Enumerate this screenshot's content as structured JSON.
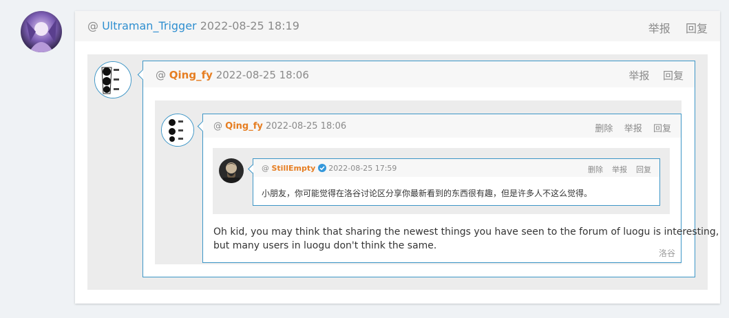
{
  "outer": {
    "at": "@",
    "username": "Ultraman_Trigger",
    "time": "2022-08-25 18:19",
    "report_label": "举报",
    "reply_label": "回复"
  },
  "level1": {
    "at": "@",
    "username": "Qing_fy",
    "time": "2022-08-25 18:06",
    "report_label": "举报",
    "reply_label": "回复"
  },
  "level2": {
    "at": "@",
    "username": "Qing_fy",
    "time": "2022-08-25 18:06",
    "delete_label": "删除",
    "report_label": "举报",
    "reply_label": "回复",
    "body_line1": "Oh kid, you may think that sharing the newest things you have seen to the forum of luogu is interesting,",
    "body_line2": "but many users in luogu don't think the same.",
    "footer": "洛谷"
  },
  "level3": {
    "at": "@",
    "username": "StillEmpty",
    "time": "2022-08-25 17:59",
    "delete_label": "删除",
    "report_label": "举报",
    "reply_label": "回复",
    "body": "小朋友，你可能觉得在洛谷讨论区分享你最新看到的东西很有趣，但是许多人不这么觉得。"
  },
  "colors": {
    "link_blue": "#2f8fd0",
    "username_orange": "#e67e22",
    "bubble_border": "#3c95c6",
    "verified_blue": "#3498db"
  },
  "icons": {
    "verified": "verified-badge-icon"
  }
}
